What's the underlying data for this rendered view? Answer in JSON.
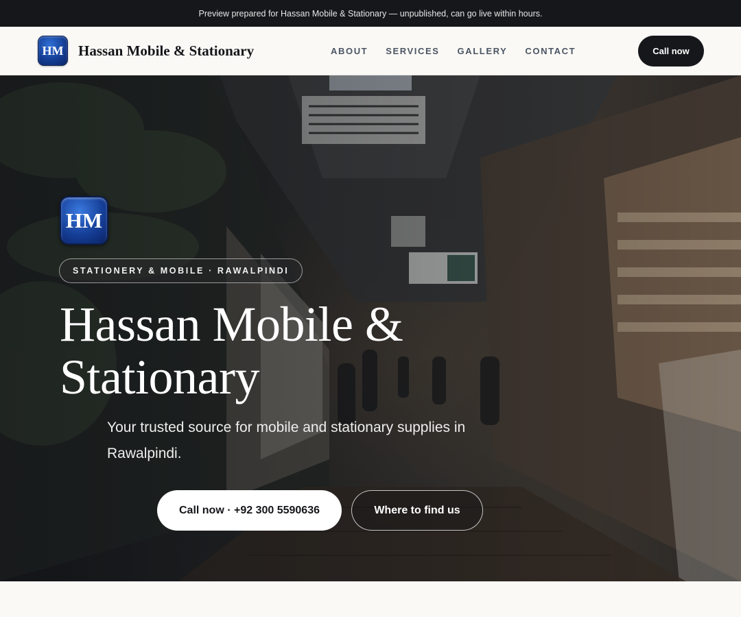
{
  "topbar": {
    "text": "Preview prepared for Hassan Mobile & Stationary — unpublished, can go live within hours."
  },
  "nav": {
    "logo_initials": "HM",
    "brand_name": "Hassan Mobile & Stationary",
    "links": [
      {
        "label": "ABOUT"
      },
      {
        "label": "SERVICES"
      },
      {
        "label": "GALLERY"
      },
      {
        "label": "CONTACT"
      }
    ],
    "cta_label": "Call now"
  },
  "hero": {
    "logo_initials": "HM",
    "eyebrow": "STATIONERY & MOBILE · RAWALPINDI",
    "title_line1": "Hassan Mobile &",
    "title_line2": "Stationary",
    "subtitle": "Your trusted source for mobile and stationary supplies in Rawalpindi.",
    "primary_button": "Call now · +92 300 5590636",
    "secondary_button": "Where to find us"
  },
  "colors": {
    "dark": "#16171b",
    "background": "#faf9f6",
    "logo_blue": "#153f95",
    "nav_text": "#4b5563"
  },
  "icons": {
    "hero_background": "market-aisle-photo"
  }
}
